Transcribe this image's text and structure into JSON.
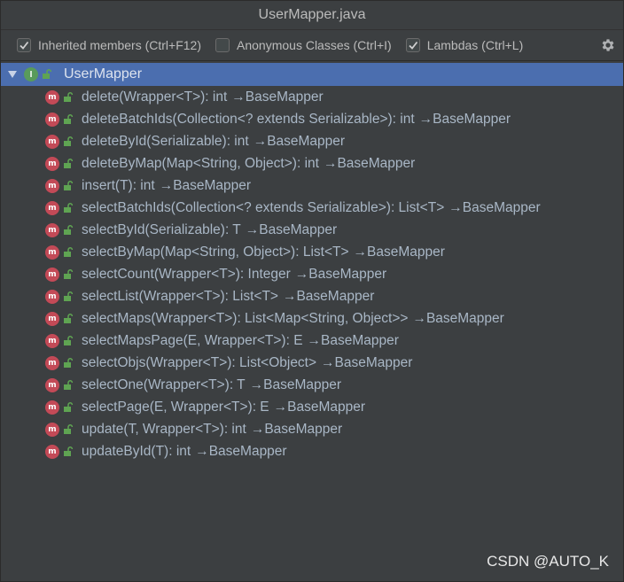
{
  "window": {
    "title": "UserMapper.java"
  },
  "toolbar": {
    "options": [
      {
        "label": "Inherited members (Ctrl+F12)",
        "checked": true
      },
      {
        "label": "Anonymous Classes (Ctrl+I)",
        "checked": false
      },
      {
        "label": "Lambdas (Ctrl+L)",
        "checked": true
      }
    ],
    "settings_icon": "gear-icon"
  },
  "tree": {
    "root": {
      "label": "UserMapper",
      "icon": "interface-icon",
      "expanded": true
    },
    "methods": [
      {
        "signature": "delete(Wrapper<T>): int",
        "origin": "→BaseMapper"
      },
      {
        "signature": "deleteBatchIds(Collection<? extends Serializable>): int",
        "origin": "→BaseMapper"
      },
      {
        "signature": "deleteById(Serializable): int",
        "origin": "→BaseMapper"
      },
      {
        "signature": "deleteByMap(Map<String, Object>): int",
        "origin": "→BaseMapper"
      },
      {
        "signature": "insert(T): int",
        "origin": "→BaseMapper"
      },
      {
        "signature": "selectBatchIds(Collection<? extends Serializable>): List<T>",
        "origin": "→BaseMapper"
      },
      {
        "signature": "selectById(Serializable): T",
        "origin": "→BaseMapper"
      },
      {
        "signature": "selectByMap(Map<String, Object>): List<T>",
        "origin": "→BaseMapper"
      },
      {
        "signature": "selectCount(Wrapper<T>): Integer",
        "origin": "→BaseMapper"
      },
      {
        "signature": "selectList(Wrapper<T>): List<T>",
        "origin": "→BaseMapper"
      },
      {
        "signature": "selectMaps(Wrapper<T>): List<Map<String, Object>>",
        "origin": "→BaseMapper"
      },
      {
        "signature": "selectMapsPage(E, Wrapper<T>): E",
        "origin": "→BaseMapper"
      },
      {
        "signature": "selectObjs(Wrapper<T>): List<Object>",
        "origin": "→BaseMapper"
      },
      {
        "signature": "selectOne(Wrapper<T>): T",
        "origin": "→BaseMapper"
      },
      {
        "signature": "selectPage(E, Wrapper<T>): E",
        "origin": "→BaseMapper"
      },
      {
        "signature": "update(T, Wrapper<T>): int",
        "origin": "→BaseMapper"
      },
      {
        "signature": "updateById(T): int",
        "origin": "→BaseMapper"
      }
    ]
  },
  "watermark": "CSDN @AUTO_K",
  "colors": {
    "background": "#3c3f41",
    "selection": "#4b6eaf",
    "text": "#a9b7c6",
    "method_icon": "#c34a57",
    "interface_icon": "#599b5b",
    "lock": "#5fa452"
  }
}
